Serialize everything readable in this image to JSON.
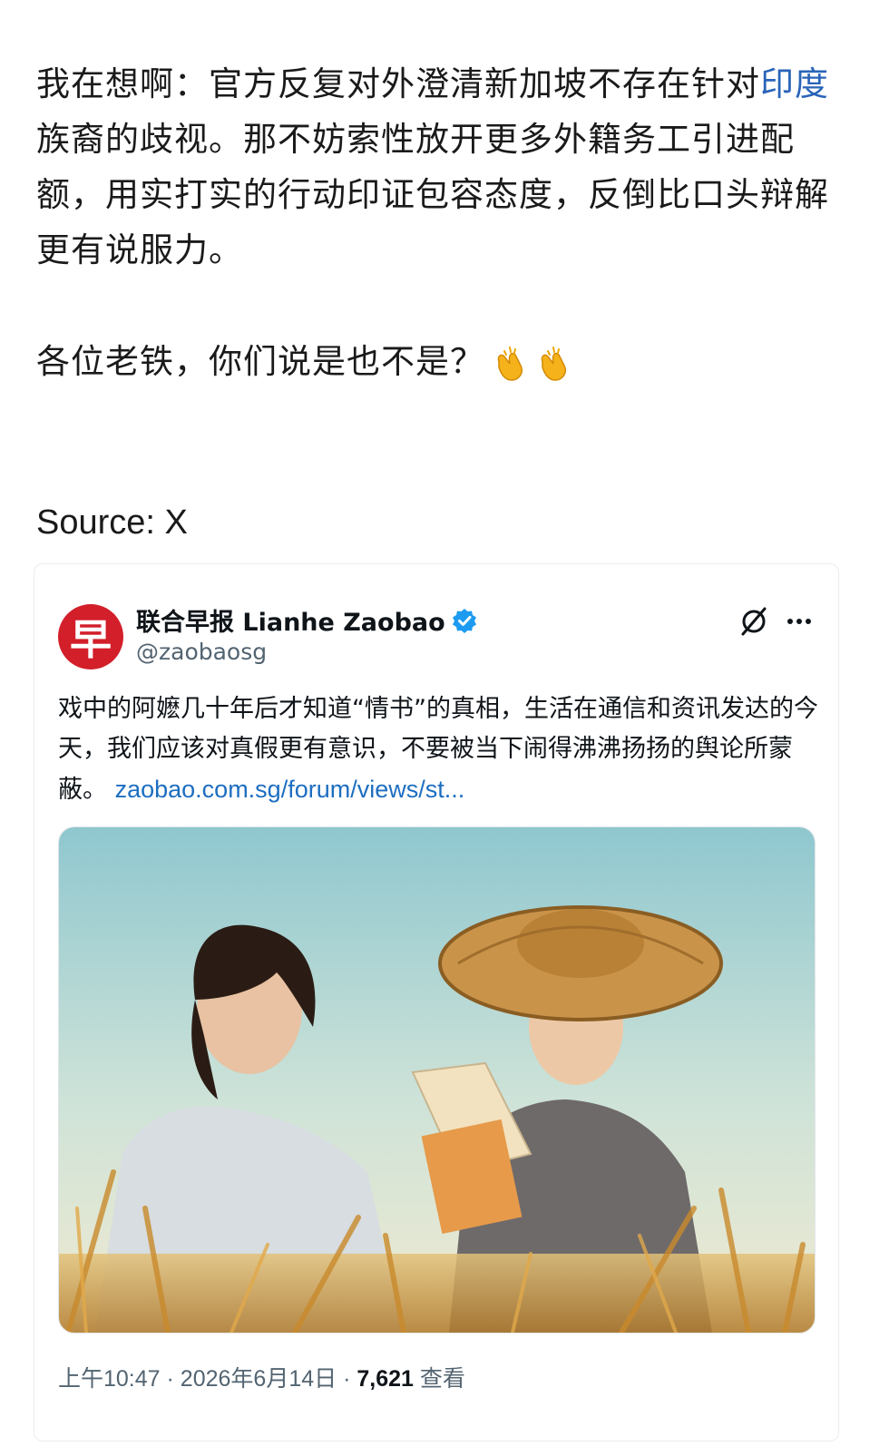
{
  "post": {
    "paragraph_before_link": "我在想啊：官方反复对外澄清新加坡不存在针对",
    "link_text": "印度",
    "paragraph_after_link": "族裔的歧视。那不妨索性放开更多外籍务工引进配额，用实打实的行动印证包容态度，反倒比口头辩解更有说服力。",
    "question": "各位老铁，你们说是也不是？",
    "emoji_icons": [
      "clapping-hands-icon",
      "clapping-hands-icon"
    ]
  },
  "source_label": "Source: X",
  "tweet": {
    "avatar_glyph": "早",
    "author_name": "联合早报 Lianhe Zaobao",
    "author_handle": "@zaobaosg",
    "text": "戏中的阿嬷几十年后才知道“情书”的真相，生活在通信和资讯发达的今天，我们应该对真假更有意识，不要被当下闹得沸沸扬扬的舆论所蒙蔽。",
    "link": "zaobao.com.sg/forum/views/st...",
    "time": "上午10:47",
    "separator": "·",
    "date": "2026年6月14日",
    "views_count": "7,621",
    "views_label": "查看",
    "icons": {
      "verified": "verified-badge-icon",
      "grok": "grok-icon",
      "more": "more-options-icon"
    }
  },
  "colors": {
    "link_blue": "#2a64b8",
    "verified_blue": "#1d9bf0",
    "avatar_red": "#d21f2a",
    "meta_gray": "#536471"
  }
}
